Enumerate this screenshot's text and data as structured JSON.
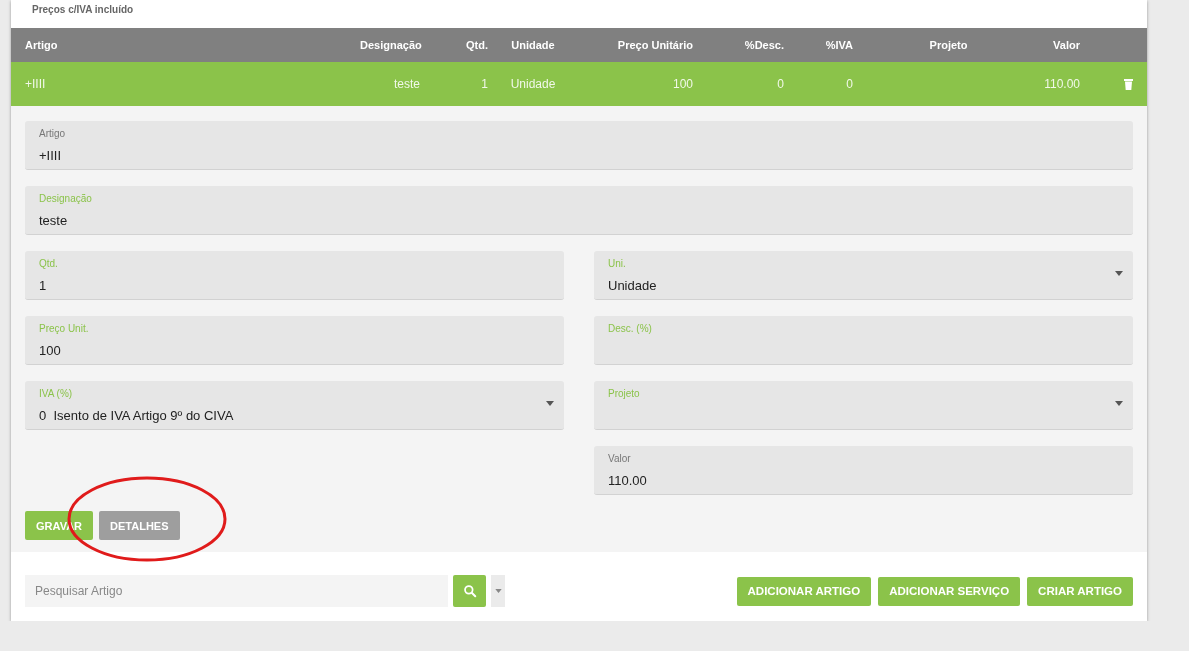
{
  "price_note": "Preços c/IVA incluído",
  "table": {
    "columns": [
      "Artigo",
      "Designação",
      "Qtd.",
      "Unidade",
      "Preço Unitário",
      "%Desc.",
      "%IVA",
      "Projeto",
      "Valor"
    ],
    "rows": [
      {
        "cells": [
          "+IIII",
          "teste",
          "1",
          "Unidade",
          "100",
          "0",
          "0",
          null,
          "110.00"
        ],
        "selected": true
      }
    ]
  },
  "form": {
    "wide_fields": [
      {
        "label": "Artigo",
        "value": "+IIII",
        "kind": "text",
        "highlighted": false
      },
      {
        "label": "Designação",
        "value": "teste",
        "kind": "text",
        "highlighted": true
      }
    ],
    "fields": [
      {
        "label": "Qtd.",
        "value": "1",
        "kind": "text",
        "highlighted": true
      },
      {
        "label": "Uni.",
        "value": "Unidade",
        "kind": "select",
        "highlighted": true
      },
      {
        "label": "Preço Unit.",
        "value": "100",
        "kind": "text",
        "highlighted": true
      },
      {
        "label": "Desc. (%)",
        "kind": "text",
        "highlighted": true
      },
      {
        "label": "IVA (%)",
        "value": "0  Isento de IVA Artigo 9º do CIVA",
        "kind": "select",
        "highlighted": true
      },
      {
        "label": "Projeto",
        "kind": "select",
        "highlighted": true
      },
      {
        "kind": "spacer"
      },
      {
        "label": "Valor",
        "value": "110.00",
        "kind": "text",
        "highlighted": false
      }
    ],
    "buttons": [
      {
        "label": "GRAVAR",
        "kind": "primary"
      },
      {
        "label": "DETALHES",
        "kind": "secondary"
      }
    ]
  },
  "search": {
    "placeholder": "Pesquisar Artigo"
  },
  "actions": [
    "ADICIONAR ARTIGO",
    "ADICIONAR SERVIÇO",
    "CRIAR ARTIGO"
  ]
}
